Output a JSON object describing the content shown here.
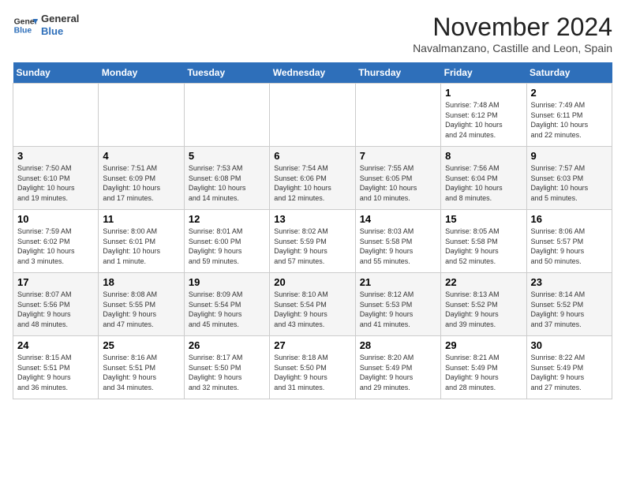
{
  "logo": {
    "line1": "General",
    "line2": "Blue"
  },
  "title": "November 2024",
  "location": "Navalmanzano, Castille and Leon, Spain",
  "weekdays": [
    "Sunday",
    "Monday",
    "Tuesday",
    "Wednesday",
    "Thursday",
    "Friday",
    "Saturday"
  ],
  "weeks": [
    [
      {
        "day": "",
        "info": ""
      },
      {
        "day": "",
        "info": ""
      },
      {
        "day": "",
        "info": ""
      },
      {
        "day": "",
        "info": ""
      },
      {
        "day": "",
        "info": ""
      },
      {
        "day": "1",
        "info": "Sunrise: 7:48 AM\nSunset: 6:12 PM\nDaylight: 10 hours\nand 24 minutes."
      },
      {
        "day": "2",
        "info": "Sunrise: 7:49 AM\nSunset: 6:11 PM\nDaylight: 10 hours\nand 22 minutes."
      }
    ],
    [
      {
        "day": "3",
        "info": "Sunrise: 7:50 AM\nSunset: 6:10 PM\nDaylight: 10 hours\nand 19 minutes."
      },
      {
        "day": "4",
        "info": "Sunrise: 7:51 AM\nSunset: 6:09 PM\nDaylight: 10 hours\nand 17 minutes."
      },
      {
        "day": "5",
        "info": "Sunrise: 7:53 AM\nSunset: 6:08 PM\nDaylight: 10 hours\nand 14 minutes."
      },
      {
        "day": "6",
        "info": "Sunrise: 7:54 AM\nSunset: 6:06 PM\nDaylight: 10 hours\nand 12 minutes."
      },
      {
        "day": "7",
        "info": "Sunrise: 7:55 AM\nSunset: 6:05 PM\nDaylight: 10 hours\nand 10 minutes."
      },
      {
        "day": "8",
        "info": "Sunrise: 7:56 AM\nSunset: 6:04 PM\nDaylight: 10 hours\nand 8 minutes."
      },
      {
        "day": "9",
        "info": "Sunrise: 7:57 AM\nSunset: 6:03 PM\nDaylight: 10 hours\nand 5 minutes."
      }
    ],
    [
      {
        "day": "10",
        "info": "Sunrise: 7:59 AM\nSunset: 6:02 PM\nDaylight: 10 hours\nand 3 minutes."
      },
      {
        "day": "11",
        "info": "Sunrise: 8:00 AM\nSunset: 6:01 PM\nDaylight: 10 hours\nand 1 minute."
      },
      {
        "day": "12",
        "info": "Sunrise: 8:01 AM\nSunset: 6:00 PM\nDaylight: 9 hours\nand 59 minutes."
      },
      {
        "day": "13",
        "info": "Sunrise: 8:02 AM\nSunset: 5:59 PM\nDaylight: 9 hours\nand 57 minutes."
      },
      {
        "day": "14",
        "info": "Sunrise: 8:03 AM\nSunset: 5:58 PM\nDaylight: 9 hours\nand 55 minutes."
      },
      {
        "day": "15",
        "info": "Sunrise: 8:05 AM\nSunset: 5:58 PM\nDaylight: 9 hours\nand 52 minutes."
      },
      {
        "day": "16",
        "info": "Sunrise: 8:06 AM\nSunset: 5:57 PM\nDaylight: 9 hours\nand 50 minutes."
      }
    ],
    [
      {
        "day": "17",
        "info": "Sunrise: 8:07 AM\nSunset: 5:56 PM\nDaylight: 9 hours\nand 48 minutes."
      },
      {
        "day": "18",
        "info": "Sunrise: 8:08 AM\nSunset: 5:55 PM\nDaylight: 9 hours\nand 47 minutes."
      },
      {
        "day": "19",
        "info": "Sunrise: 8:09 AM\nSunset: 5:54 PM\nDaylight: 9 hours\nand 45 minutes."
      },
      {
        "day": "20",
        "info": "Sunrise: 8:10 AM\nSunset: 5:54 PM\nDaylight: 9 hours\nand 43 minutes."
      },
      {
        "day": "21",
        "info": "Sunrise: 8:12 AM\nSunset: 5:53 PM\nDaylight: 9 hours\nand 41 minutes."
      },
      {
        "day": "22",
        "info": "Sunrise: 8:13 AM\nSunset: 5:52 PM\nDaylight: 9 hours\nand 39 minutes."
      },
      {
        "day": "23",
        "info": "Sunrise: 8:14 AM\nSunset: 5:52 PM\nDaylight: 9 hours\nand 37 minutes."
      }
    ],
    [
      {
        "day": "24",
        "info": "Sunrise: 8:15 AM\nSunset: 5:51 PM\nDaylight: 9 hours\nand 36 minutes."
      },
      {
        "day": "25",
        "info": "Sunrise: 8:16 AM\nSunset: 5:51 PM\nDaylight: 9 hours\nand 34 minutes."
      },
      {
        "day": "26",
        "info": "Sunrise: 8:17 AM\nSunset: 5:50 PM\nDaylight: 9 hours\nand 32 minutes."
      },
      {
        "day": "27",
        "info": "Sunrise: 8:18 AM\nSunset: 5:50 PM\nDaylight: 9 hours\nand 31 minutes."
      },
      {
        "day": "28",
        "info": "Sunrise: 8:20 AM\nSunset: 5:49 PM\nDaylight: 9 hours\nand 29 minutes."
      },
      {
        "day": "29",
        "info": "Sunrise: 8:21 AM\nSunset: 5:49 PM\nDaylight: 9 hours\nand 28 minutes."
      },
      {
        "day": "30",
        "info": "Sunrise: 8:22 AM\nSunset: 5:49 PM\nDaylight: 9 hours\nand 27 minutes."
      }
    ]
  ]
}
